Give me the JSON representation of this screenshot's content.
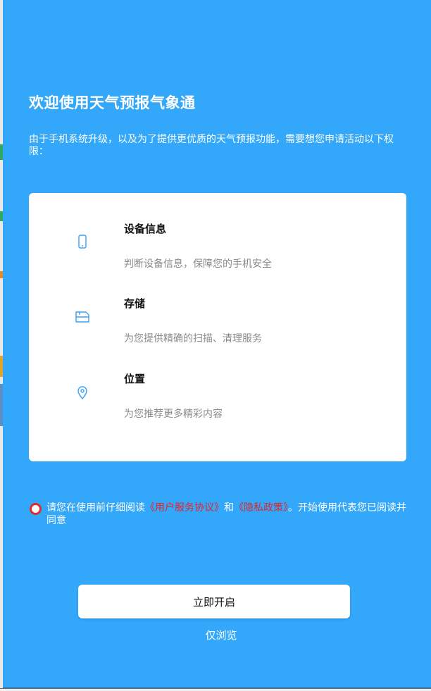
{
  "dialog": {
    "title": "欢迎使用天气预报气象通",
    "intro": "由于手机系统升级，以及为了提供更优质的天气预报功能，需要想您申请活动以下权限：",
    "permissions": [
      {
        "name": "设备信息",
        "desc": "判断设备信息，保障您的手机安全",
        "icon": "phone-icon"
      },
      {
        "name": "存储",
        "desc": "为您提供精确的扫描、清理服务",
        "icon": "storage-icon"
      },
      {
        "name": "位置",
        "desc": "为您推荐更多精彩内容",
        "icon": "location-icon"
      }
    ],
    "agreement": {
      "checked": false,
      "prefix": "请您在使用前仔细阅读",
      "user_agreement_link": "《用户服务协议》",
      "and": "和",
      "privacy_link": "《隐私政策》",
      "suffix": "。开始使用代表您已阅读并同意"
    },
    "primary_button": "立即开启",
    "secondary_button": "仅浏览"
  },
  "colors": {
    "dialog_background": "#33a8fb",
    "card_background": "#ffffff",
    "link_red": "#e1252a",
    "icon_blue": "#3aa0f5"
  }
}
